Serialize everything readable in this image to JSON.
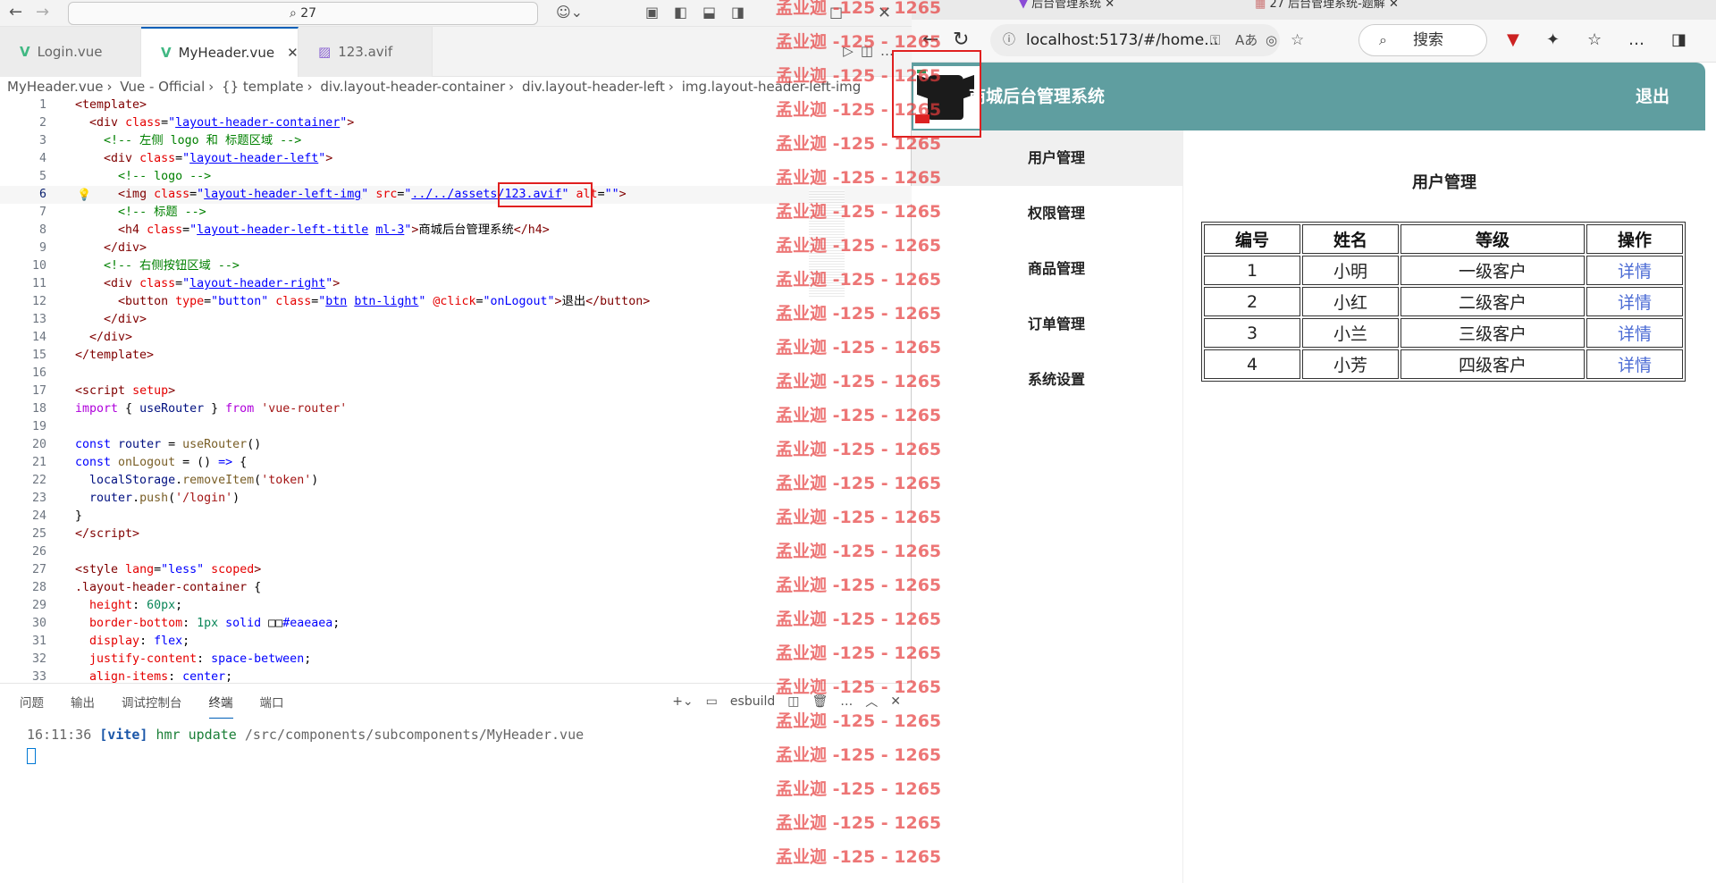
{
  "vscode": {
    "command_center": "27",
    "tabs": [
      {
        "label": "Login.vue"
      },
      {
        "label": "MyHeader.vue"
      },
      {
        "label": "123.avif"
      }
    ],
    "breadcrumb": [
      "MyHeader.vue",
      "Vue - Official",
      "{} template",
      "div.layout-header-container",
      "div.layout-header-left",
      "img.layout-header-left-img"
    ],
    "panel_tabs": [
      "问题",
      "输出",
      "调试控制台",
      "终端",
      "端口"
    ],
    "panel_right": "esbuild",
    "terminal": {
      "time": "16:11:36",
      "tag": "[vite]",
      "action": "hmr update",
      "path": "/src/components/subcomponents/MyHeader.vue"
    }
  },
  "browser": {
    "tabs": [
      "后台管理系统",
      "27 后台管理系统-题解"
    ],
    "url": "localhost:5173/#/home...",
    "search_placeholder": "搜索"
  },
  "app": {
    "title": "商城后台管理系统",
    "logout": "退出",
    "menu": [
      "用户管理",
      "权限管理",
      "商品管理",
      "订单管理",
      "系统设置"
    ],
    "page_title": "用户管理",
    "table": {
      "headers": [
        "编号",
        "姓名",
        "等级",
        "操作"
      ],
      "rows": [
        {
          "id": "1",
          "name": "小明",
          "level": "一级客户",
          "action": "详情"
        },
        {
          "id": "2",
          "name": "小红",
          "level": "二级客户",
          "action": "详情"
        },
        {
          "id": "3",
          "name": "小兰",
          "level": "三级客户",
          "action": "详情"
        },
        {
          "id": "4",
          "name": "小芳",
          "level": "四级客户",
          "action": "详情"
        }
      ]
    }
  },
  "watermark": "孟业迦 -125 - 1265"
}
